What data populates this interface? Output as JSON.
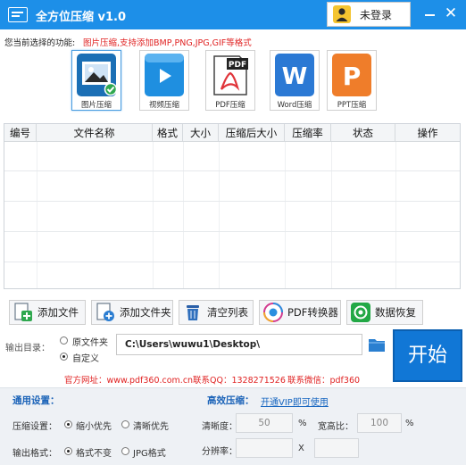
{
  "app": {
    "title": "全方位压缩 v1.0",
    "login_label": "未登录",
    "close_glyph": "✕",
    "icons": [
      "app-logo-icon",
      "user-icon",
      "minimize-icon",
      "close-icon"
    ]
  },
  "func": {
    "label": "您当前选择的功能:",
    "hint": "图片压缩,支持添加BMP,PNG,JPG,GIF等格式"
  },
  "tiles": [
    {
      "label": "图片压缩",
      "icon": "image-icon",
      "active": true
    },
    {
      "label": "视频压缩",
      "icon": "video-icon"
    },
    {
      "label": "PDF压缩",
      "icon": "pdf-icon",
      "badge": "PDF"
    },
    {
      "label": "Word压缩",
      "icon": "word-icon",
      "letter": "W"
    },
    {
      "label": "PPT压缩",
      "icon": "ppt-icon",
      "letter": "P"
    }
  ],
  "table": {
    "columns": [
      "编号",
      "文件名称",
      "格式",
      "大小",
      "压缩后大小",
      "压缩率",
      "状态",
      "操作"
    ],
    "rows": []
  },
  "toolbar": [
    {
      "label": "添加文件",
      "icon": "add-file-icon"
    },
    {
      "label": "添加文件夹",
      "icon": "add-folder-icon"
    },
    {
      "label": "清空列表",
      "icon": "trash-icon"
    },
    {
      "label": "PDF转换器",
      "icon": "pdf-converter-icon"
    },
    {
      "label": "数据恢复",
      "icon": "data-recovery-icon"
    }
  ],
  "output": {
    "label": "输出目录：",
    "option_original": "原文件夹",
    "option_custom": "自定义",
    "selected": "custom",
    "path": "C:\\Users\\wuwu1\\Desktop\\",
    "start_label": "开始"
  },
  "contact": {
    "site": "官方网址：www.pdf360.com.cn",
    "qq": "联系QQ：1328271526",
    "wechat": "联系微信：pdf360"
  },
  "settings": {
    "general_title": "通用设置：",
    "compress_label": "压缩设置：",
    "opt_small": "缩小优先",
    "opt_clear": "清晰优先",
    "compress_selected": "small",
    "format_label": "输出格式：",
    "opt_keep": "格式不变",
    "opt_jpg": "JPG格式",
    "format_selected": "keep",
    "pro_title": "高效压缩：",
    "vip_link": "开通VIP即可使用",
    "clarity_label": "清晰度：",
    "clarity_value": "50",
    "clarity_unit": "%",
    "ratio_label": "宽高比：",
    "ratio_value": "100",
    "ratio_unit": "%",
    "resolution_label": "分辨率：",
    "resolution_sep": "X",
    "resolution_w": "",
    "resolution_h": ""
  },
  "colors": {
    "title_bar": "#1d8fe8",
    "start_button": "#1177d6",
    "hint_red": "#e02222",
    "link_blue": "#1565c0"
  }
}
